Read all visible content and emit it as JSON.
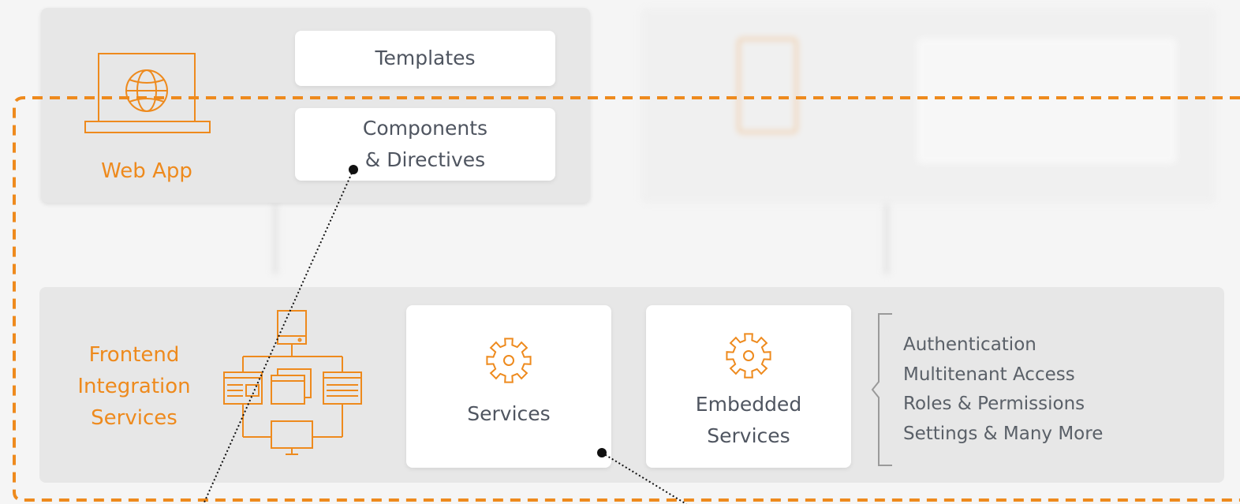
{
  "web_app": {
    "label": "Web App",
    "templates_label": "Templates",
    "components_line1": "Components",
    "components_line2": "& Directives"
  },
  "frontend": {
    "label_line1": "Frontend",
    "label_line2": "Integration",
    "label_line3": "Services",
    "services_label": "Services",
    "embedded_line1": "Embedded",
    "embedded_line2": "Services",
    "features": [
      "Authentication",
      "Multitenant Access",
      "Roles & Permissions",
      "Settings & Many More"
    ]
  },
  "colors": {
    "accent": "#ee8a1d",
    "panel": "#e7e7e7",
    "card": "#ffffff",
    "text": "#4f5560"
  }
}
